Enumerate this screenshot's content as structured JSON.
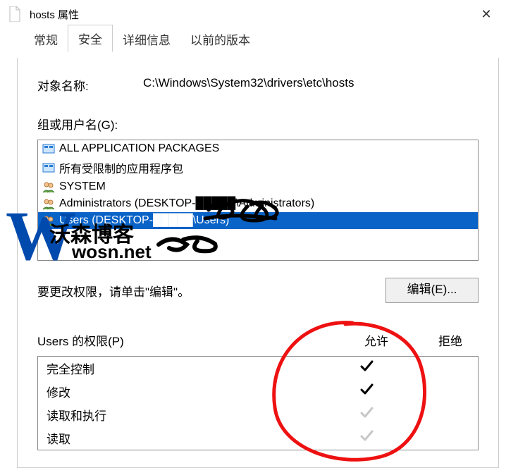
{
  "window": {
    "title": "hosts 属性",
    "close_tooltip": "Close"
  },
  "tabs": [
    {
      "id": "general",
      "label": "常规"
    },
    {
      "id": "security",
      "label": "安全"
    },
    {
      "id": "details",
      "label": "详细信息"
    },
    {
      "id": "previous",
      "label": "以前的版本"
    }
  ],
  "active_tab": "security",
  "object": {
    "label": "对象名称:",
    "path": "C:\\Windows\\System32\\drivers\\etc\\hosts"
  },
  "groups": {
    "label": "组或用户名(G):",
    "items": [
      {
        "icon": "package",
        "text": "ALL APPLICATION PACKAGES",
        "selected": false
      },
      {
        "icon": "package",
        "text": "所有受限制的应用程序包",
        "selected": false
      },
      {
        "icon": "users",
        "text": "SYSTEM",
        "selected": false
      },
      {
        "icon": "users",
        "text": "Administrators (DESKTOP-█████\\Administrators)",
        "selected": false
      },
      {
        "icon": "users",
        "text": "Users (DESKTOP-█████\\Users)",
        "selected": true
      }
    ]
  },
  "edit": {
    "msg": "要更改权限，请单击\"编辑\"。",
    "button": "编辑(E)..."
  },
  "permissions": {
    "header_label": "Users 的权限(P)",
    "allow_label": "允许",
    "deny_label": "拒绝",
    "rows": [
      {
        "name": "完全控制",
        "allow": "dark",
        "deny": "none"
      },
      {
        "name": "修改",
        "allow": "dark",
        "deny": "none"
      },
      {
        "name": "读取和执行",
        "allow": "light",
        "deny": "none"
      },
      {
        "name": "读取",
        "allow": "light",
        "deny": "none"
      }
    ]
  },
  "watermark": {
    "brand": "沃森博客",
    "url": "wosn.net"
  }
}
